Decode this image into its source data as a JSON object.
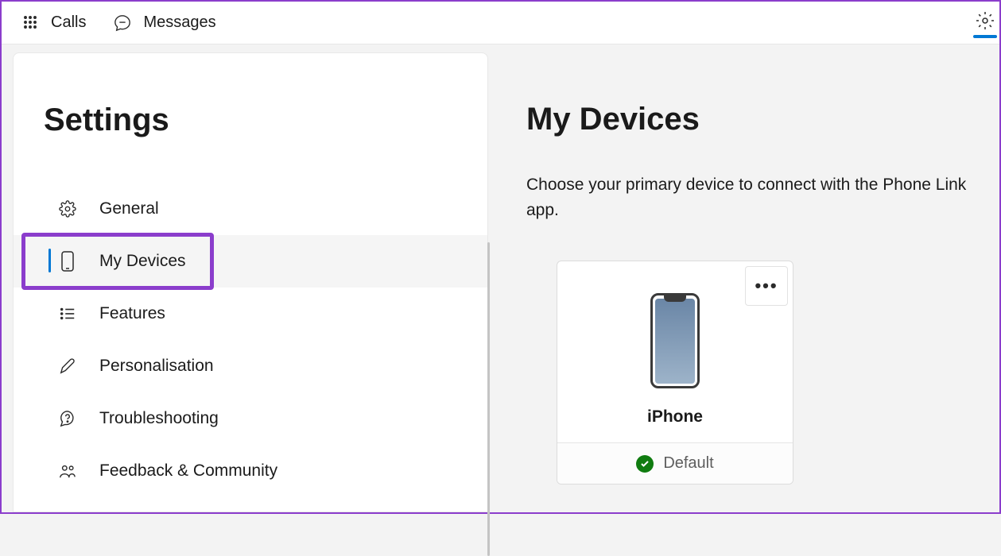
{
  "topbar": {
    "calls_label": "Calls",
    "messages_label": "Messages"
  },
  "sidebar": {
    "title": "Settings",
    "items": [
      {
        "label": "General"
      },
      {
        "label": "My Devices"
      },
      {
        "label": "Features"
      },
      {
        "label": "Personalisation"
      },
      {
        "label": "Troubleshooting"
      },
      {
        "label": "Feedback & Community"
      }
    ]
  },
  "main": {
    "title": "My Devices",
    "description": "Choose your primary device to connect with the Phone Link app.",
    "device": {
      "name": "iPhone",
      "status": "Default"
    }
  }
}
